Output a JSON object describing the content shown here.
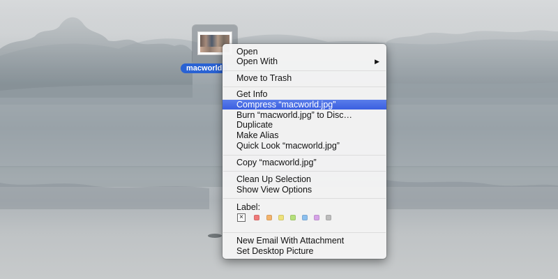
{
  "desktop": {
    "file_name": "macworld.jpg",
    "file_label_visible": "macworld"
  },
  "menu": {
    "groups": [
      [
        "Open",
        "Open With"
      ],
      [
        "Move to Trash"
      ],
      [
        "Get Info",
        "Compress “macworld.jpg”",
        "Burn “macworld.jpg” to Disc…",
        "Duplicate",
        "Make Alias",
        "Quick Look “macworld.jpg”"
      ],
      [
        "Copy “macworld.jpg”"
      ],
      [
        "Clean Up Selection",
        "Show View Options"
      ],
      [
        "New Email With Attachment",
        "Set Desktop Picture"
      ]
    ],
    "highlighted_item": "Compress “macworld.jpg”",
    "submenu_arrow": "▶",
    "label_section": {
      "title": "Label:",
      "none_glyph": "×",
      "colors": [
        {
          "name": "red",
          "hex": "#f07a7a"
        },
        {
          "name": "orange",
          "hex": "#f3b36b"
        },
        {
          "name": "yellow",
          "hex": "#eee27a"
        },
        {
          "name": "green",
          "hex": "#b5e07a"
        },
        {
          "name": "blue",
          "hex": "#8cc0ef"
        },
        {
          "name": "purple",
          "hex": "#d6a3e8"
        },
        {
          "name": "gray",
          "hex": "#bdbdbd"
        }
      ]
    }
  },
  "colors": {
    "highlight": "#3a5fe0",
    "selection_label": "#2a62d3"
  }
}
